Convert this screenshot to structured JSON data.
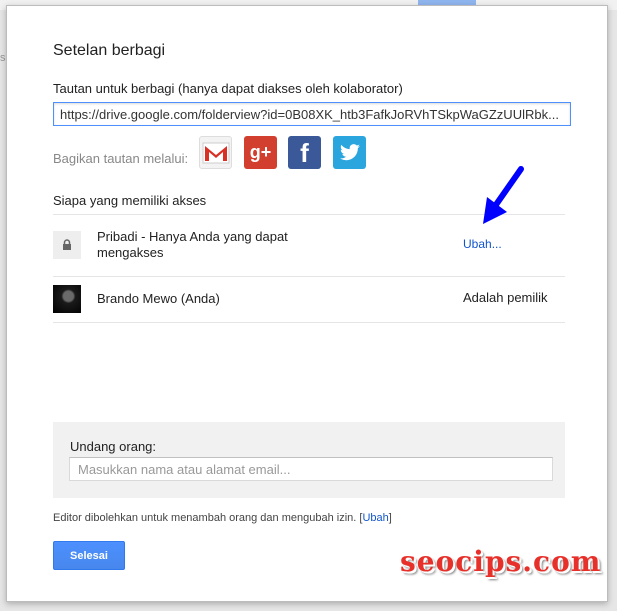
{
  "dialog": {
    "title": "Setelan berbagi",
    "link_label": "Tautan untuk berbagi (hanya dapat diakses oleh kolaborator)",
    "link_url": "https://drive.google.com/folderview?id=0B08XK_htb3FafkJoRVhTSkpWaGZzUUlRbk...",
    "share_via_label": "Bagikan tautan melalui:",
    "share_icons": [
      "gmail-icon",
      "google-plus-icon",
      "facebook-icon",
      "twitter-icon"
    ],
    "access_title": "Siapa yang memiliki akses",
    "privacy": {
      "text": "Pribadi - Hanya Anda yang dapat mengakses",
      "change_link": "Ubah..."
    },
    "owner": {
      "name": "Brando Mewo (Anda)",
      "role": "Adalah pemilik"
    },
    "invite": {
      "label": "Undang orang:",
      "placeholder": "Masukkan nama atau alamat email..."
    },
    "footer_note": "Editor dibolehkan untuk menambah orang dan mengubah izin.",
    "footer_link": "Ubah",
    "done_button": "Selesai"
  },
  "background": {
    "hint": "s"
  },
  "watermark": "seocips.com",
  "colors": {
    "accent_blue": "#4d90fe",
    "link_blue": "#1155cc",
    "arrow_blue": "#0000ff",
    "watermark_red": "#e8302a"
  }
}
